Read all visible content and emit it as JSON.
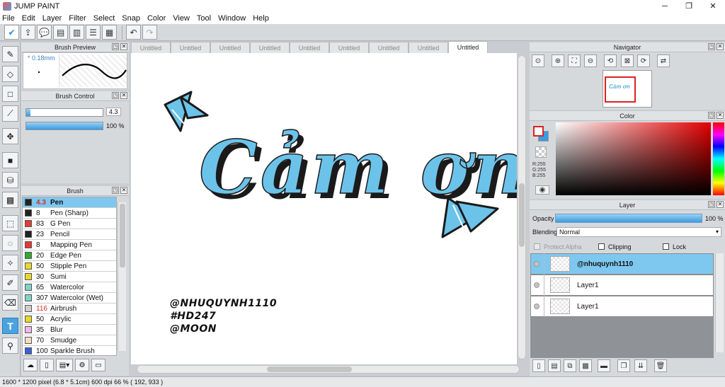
{
  "window": {
    "title": "JUMP PAINT",
    "minimize": "─",
    "maximize": "❐",
    "close": "✕"
  },
  "menu": [
    "File",
    "Edit",
    "Layer",
    "Filter",
    "Select",
    "Snap",
    "Color",
    "View",
    "Tool",
    "Window",
    "Help"
  ],
  "panels": {
    "brush_preview": {
      "title": "Brush Preview",
      "size": "* 0.18mm"
    },
    "brush_control": {
      "title": "Brush Control",
      "size_value": "4.3",
      "opacity": 1.0,
      "opacity_label": "100 %"
    },
    "brush": {
      "title": "Brush",
      "items": [
        {
          "size": "4.3",
          "name": "Pen",
          "color": "#222222",
          "selected": true,
          "size_color": "#d32f2f"
        },
        {
          "size": "8",
          "name": "Pen (Sharp)",
          "color": "#222222"
        },
        {
          "size": "83",
          "name": "G Pen",
          "color": "#e53935"
        },
        {
          "size": "23",
          "name": "Pencil",
          "color": "#222222"
        },
        {
          "size": "8",
          "name": "Mapping Pen",
          "color": "#e53935"
        },
        {
          "size": "20",
          "name": "Edge Pen",
          "color": "#2eaa2e"
        },
        {
          "size": "50",
          "name": "Stipple Pen",
          "color": "#e8d82a"
        },
        {
          "size": "30",
          "name": "Sumi",
          "color": "#e8d82a"
        },
        {
          "size": "65",
          "name": "Watercolor",
          "color": "#7fd4c8"
        },
        {
          "size": "307",
          "name": "Watercolor (Wet)",
          "color": "#7fd4c8"
        },
        {
          "size": "116",
          "name": "Airbrush",
          "color": "#cfcfcf",
          "size_color": "#d32f2f"
        },
        {
          "size": "50",
          "name": "Acrylic",
          "color": "#e8d82a"
        },
        {
          "size": "35",
          "name": "Blur",
          "color": "#f4b6e8"
        },
        {
          "size": "70",
          "name": "Smudge",
          "color": "#f6dcc0"
        },
        {
          "size": "100",
          "name": "Sparkle Brush",
          "color": "#3a5fd8"
        }
      ]
    },
    "navigator": {
      "title": "Navigator",
      "mini_text": "Cảm ơn"
    },
    "color": {
      "title": "Color",
      "r": "R:255",
      "g": "G:255",
      "b": "B:255"
    },
    "layer": {
      "title": "Layer",
      "opacity_label": "Opacity",
      "opacity_value": "100 %",
      "opacity": 1.0,
      "blending_label": "Blending",
      "blending_value": "Normal",
      "protect_alpha": "Protect Alpha",
      "clipping": "Clipping",
      "lock": "Lock",
      "layers": [
        {
          "name": "@nhuquynh1110",
          "selected": true
        },
        {
          "name": "Layer1",
          "selected": false
        },
        {
          "name": "Layer1",
          "selected": false
        }
      ]
    }
  },
  "tabs": [
    "Untitled",
    "Untitled",
    "Untitled",
    "Untitled",
    "Untitled",
    "Untitled",
    "Untitled",
    "Untitled",
    "Untitled"
  ],
  "canvas": {
    "main_text": "Cảm ơn",
    "signature": [
      "@NHUQUYNH1110",
      "#HD247",
      "@MOON"
    ]
  },
  "status": "1600 * 1200 pixel   (6.8 * 5.1cm)   600 dpi   66 %   ( 192, 933 )",
  "colors": {
    "accent": "#4aa3df",
    "selected_row": "#7ec8f0",
    "lettering_fill": "#6cc3ea"
  }
}
